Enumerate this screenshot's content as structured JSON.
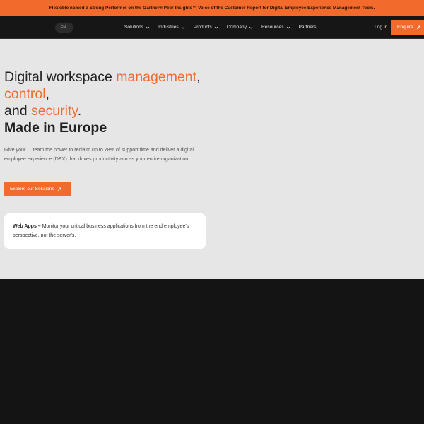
{
  "announcement": "Flexxible named a Strong Performer on the Gartner® Peer Insights™ Voice of the Customer Report for Digital Employee Experience Management Tools.",
  "nav": {
    "lang": "EN",
    "items": [
      "Solutions",
      "Industries",
      "Products",
      "Company",
      "Resources",
      "Partners"
    ],
    "login": "Log In",
    "enquire": "Enquire"
  },
  "hero": {
    "line1": "Digital workspace ",
    "line1_accent": "management",
    "line1_end": ",",
    "line2_accent": "control",
    "line2_end": ",",
    "line3": "and ",
    "line3_accent": "security",
    "line3_end": ".",
    "line4": "Made in Europe",
    "description": "Give your IT team the power to reclaim up to 78% of support time and deliver a digital employee experience (DEX) that drives productivity across your entire organization.",
    "cta": "Explore our Solutions",
    "card_title": "Web Apps –",
    "card_text": " Monitor your critical business applications from the end employee's perspective, not the server's."
  },
  "colors": {
    "accent": "#f36a2d",
    "nav_bg": "#161616",
    "hero_bg": "#e6e6e6",
    "dark_bg": "#141414"
  },
  "icons": {
    "menu_dropdown": "chevron-down-icon",
    "external_link": "arrow-up-right-icon"
  }
}
